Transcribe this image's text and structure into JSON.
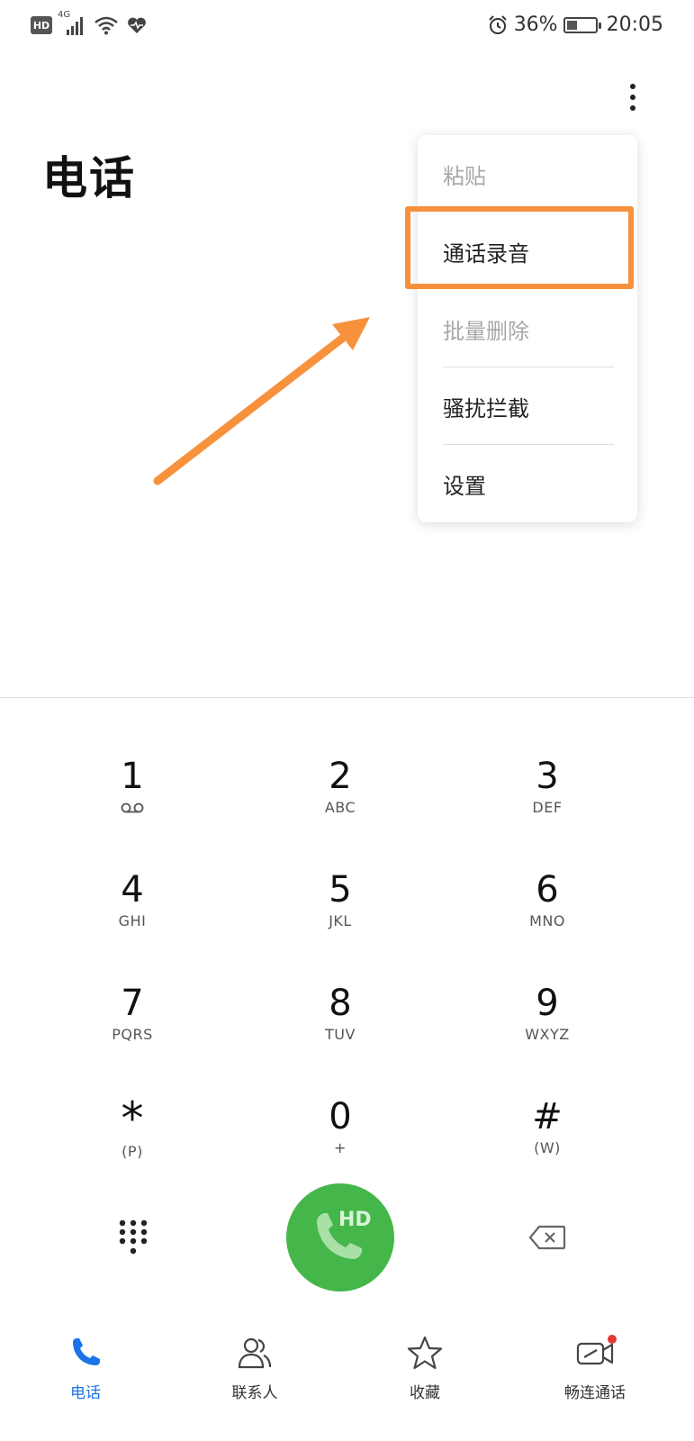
{
  "status_bar": {
    "network_badge": "HD",
    "network_type": "4G",
    "battery_percent": "36%",
    "battery_level": 0.36,
    "time": "20:05"
  },
  "header": {
    "title": "电话"
  },
  "menu": {
    "items": [
      {
        "label": "粘贴",
        "enabled": false
      },
      {
        "label": "通话录音",
        "enabled": true,
        "highlighted": true
      },
      {
        "label": "批量删除",
        "enabled": false
      },
      {
        "label": "骚扰拦截",
        "enabled": true
      },
      {
        "label": "设置",
        "enabled": true
      }
    ],
    "annotation_color": "#f7913c"
  },
  "keypad": {
    "keys": [
      {
        "digit": "1",
        "letters": ""
      },
      {
        "digit": "2",
        "letters": "ABC"
      },
      {
        "digit": "3",
        "letters": "DEF"
      },
      {
        "digit": "4",
        "letters": "GHI"
      },
      {
        "digit": "5",
        "letters": "JKL"
      },
      {
        "digit": "6",
        "letters": "MNO"
      },
      {
        "digit": "7",
        "letters": "PQRS"
      },
      {
        "digit": "8",
        "letters": "TUV"
      },
      {
        "digit": "9",
        "letters": "WXYZ"
      },
      {
        "digit": "*",
        "letters": "(P)"
      },
      {
        "digit": "0",
        "letters": "+"
      },
      {
        "digit": "#",
        "letters": "(W)"
      }
    ]
  },
  "call_button": {
    "badge": "HD",
    "color": "#45b649"
  },
  "bottom_nav": {
    "items": [
      {
        "label": "电话",
        "icon": "phone-icon",
        "active": true
      },
      {
        "label": "联系人",
        "icon": "contacts-icon",
        "active": false
      },
      {
        "label": "收藏",
        "icon": "star-icon",
        "active": false
      },
      {
        "label": "畅连通话",
        "icon": "video-call-icon",
        "active": false
      }
    ],
    "active_color": "#1a73e8"
  }
}
